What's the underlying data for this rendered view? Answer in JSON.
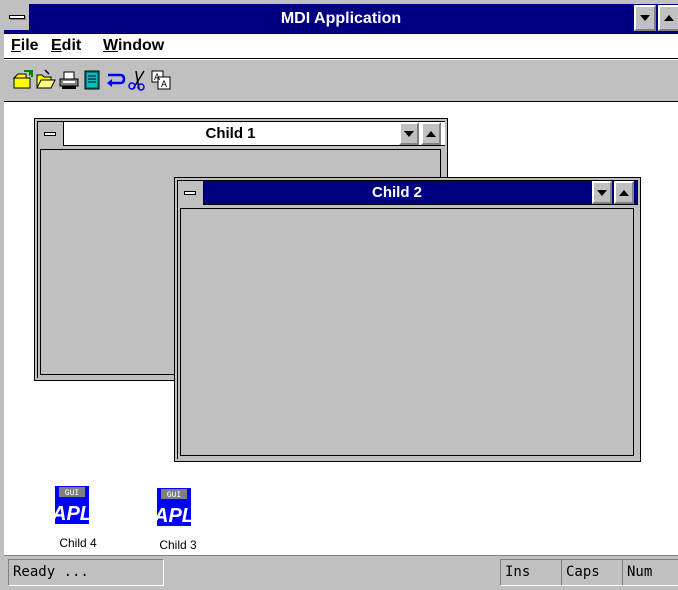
{
  "app": {
    "title": "MDI Application"
  },
  "menu": [
    {
      "label": "File",
      "mnemonic": "F",
      "rest": "ile"
    },
    {
      "label": "Edit",
      "mnemonic": "E",
      "rest": "dit"
    },
    {
      "label": "Window",
      "mnemonic": "W",
      "rest": "indow"
    }
  ],
  "toolbar": {
    "icons": [
      "new-icon",
      "open-icon",
      "print-icon",
      "document-icon",
      "undo-icon",
      "cut-icon",
      "font-icon"
    ]
  },
  "children": [
    {
      "title": "Child 1",
      "active": false
    },
    {
      "title": "Child 2",
      "active": true
    }
  ],
  "minimized": [
    {
      "badge": "GUI",
      "logo": "APL",
      "label": "Child 4"
    },
    {
      "badge": "GUI",
      "logo": "APL",
      "label": "Child 3"
    }
  ],
  "status": {
    "message": "Ready ...",
    "ins": "Ins",
    "caps": "Caps",
    "num": "Num"
  },
  "colors": {
    "active_title": "#000080",
    "window_face": "#c0c0c0",
    "workspace": "#ffffff"
  }
}
